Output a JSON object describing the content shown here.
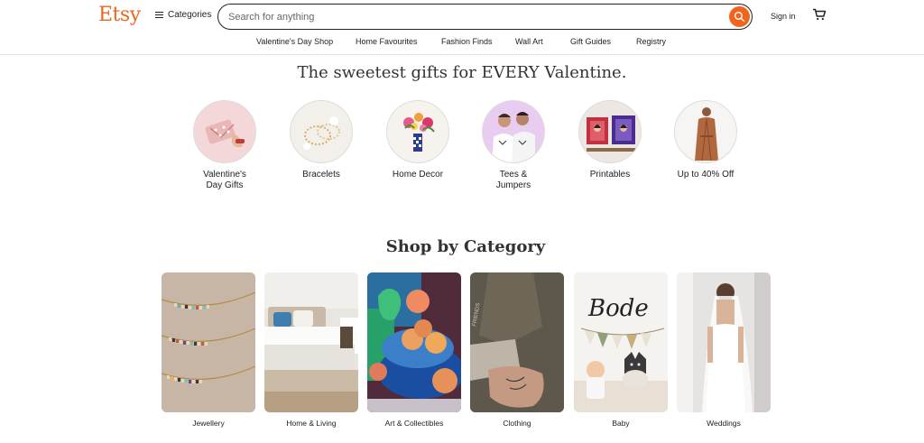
{
  "brand": {
    "logo": "Etsy",
    "accent": "#f1641e"
  },
  "header": {
    "categories_label": "Categories",
    "search_placeholder": "Search for anything",
    "sign_in": "Sign in"
  },
  "nav": [
    "Valentine's Day Shop",
    "Home Favourites",
    "Fashion Finds",
    "Wall Art",
    "Gift Guides",
    "Registry"
  ],
  "valentine": {
    "title": "The sweetest gifts for EVERY Valentine.",
    "items": [
      {
        "label": "Valentine's Day Gifts"
      },
      {
        "label": "Bracelets"
      },
      {
        "label": "Home Decor"
      },
      {
        "label": "Tees & Jumpers"
      },
      {
        "label": "Printables"
      },
      {
        "label": "Up to 40% Off"
      }
    ]
  },
  "category_section": {
    "title": "Shop by Category",
    "items": [
      {
        "label": "Jewellery"
      },
      {
        "label": "Home & Living"
      },
      {
        "label": "Art & Collectibles"
      },
      {
        "label": "Clothing"
      },
      {
        "label": "Baby"
      },
      {
        "label": "Weddings"
      }
    ],
    "baby_sign_text": "Bode"
  }
}
